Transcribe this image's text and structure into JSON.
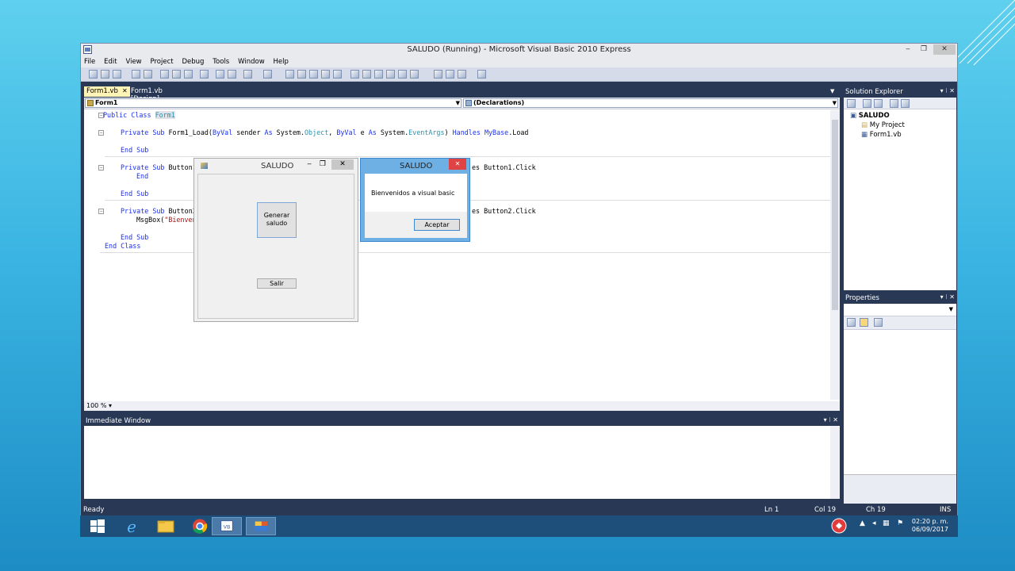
{
  "window": {
    "title": "SALUDO (Running) - Microsoft Visual Basic 2010 Express",
    "min": "‒",
    "max": "❐",
    "close": "✕"
  },
  "menu": [
    "File",
    "Edit",
    "View",
    "Project",
    "Debug",
    "Tools",
    "Window",
    "Help"
  ],
  "tabs": [
    {
      "label": "Form1.vb",
      "close": "✕"
    },
    {
      "label": "Form1.vb [Design]"
    }
  ],
  "editor": {
    "object_combo": "Form1",
    "member_combo": "(Declarations)",
    "zoom": "100 %",
    "lines": {
      "l1": {
        "kw1": "Public Class",
        "name": "Form1"
      },
      "l2": {
        "kw1": "Private Sub",
        "t1": " Form1_Load(",
        "kw2": "ByVal",
        "t2": " sender ",
        "kw3": "As",
        "t3": " System.",
        "ty1": "Object",
        "t4": ", ",
        "kw4": "ByVal",
        "t5": " e ",
        "kw5": "As",
        "t6": " System.",
        "ty2": "EventArgs",
        "t7": ") ",
        "kw6": "Handles",
        "t8": " ",
        "kw7": "MyBase",
        "t9": ".Load"
      },
      "l3": "End Sub",
      "l4": {
        "kw1": "Private Sub",
        "t1": " Button1_",
        "tail": "es Button1.Click"
      },
      "l5": "End",
      "l6": "End Sub",
      "l7": {
        "kw1": "Private Sub",
        "t1": " Button2_",
        "tail": "es Button2.Click"
      },
      "l8": {
        "t1": "MsgBox(",
        "str": "\"Bienven"
      },
      "l9": "End Sub",
      "l10": "End Class"
    }
  },
  "solution_explorer": {
    "title": "Solution Explorer",
    "ctrls": "▾ ⁝ ✕",
    "items": [
      "SALUDO",
      "My Project",
      "Form1.vb"
    ]
  },
  "properties": {
    "title": "Properties",
    "ctrls": "▾ ⁝ ✕"
  },
  "immediate": {
    "title": "Immediate Window",
    "ctrls": "▾ ⁝ ✕"
  },
  "status": {
    "ready": "Ready",
    "ln": "Ln 1",
    "col": "Col 19",
    "ch": "Ch 19",
    "ins": "INS"
  },
  "form": {
    "title": "SALUDO",
    "btn_generar": "Generar saludo",
    "btn_salir": "Salir"
  },
  "msgbox": {
    "title": "SALUDO",
    "text": "Bienvenidos a visual basic",
    "ok": "Aceptar"
  },
  "taskbar": {
    "time": "02:20 p. m.",
    "date": "06/09/2017"
  },
  "colors": {
    "accent": "#293955",
    "keyword": "#1a2ff0",
    "type": "#2b91af",
    "string": "#a31515"
  }
}
